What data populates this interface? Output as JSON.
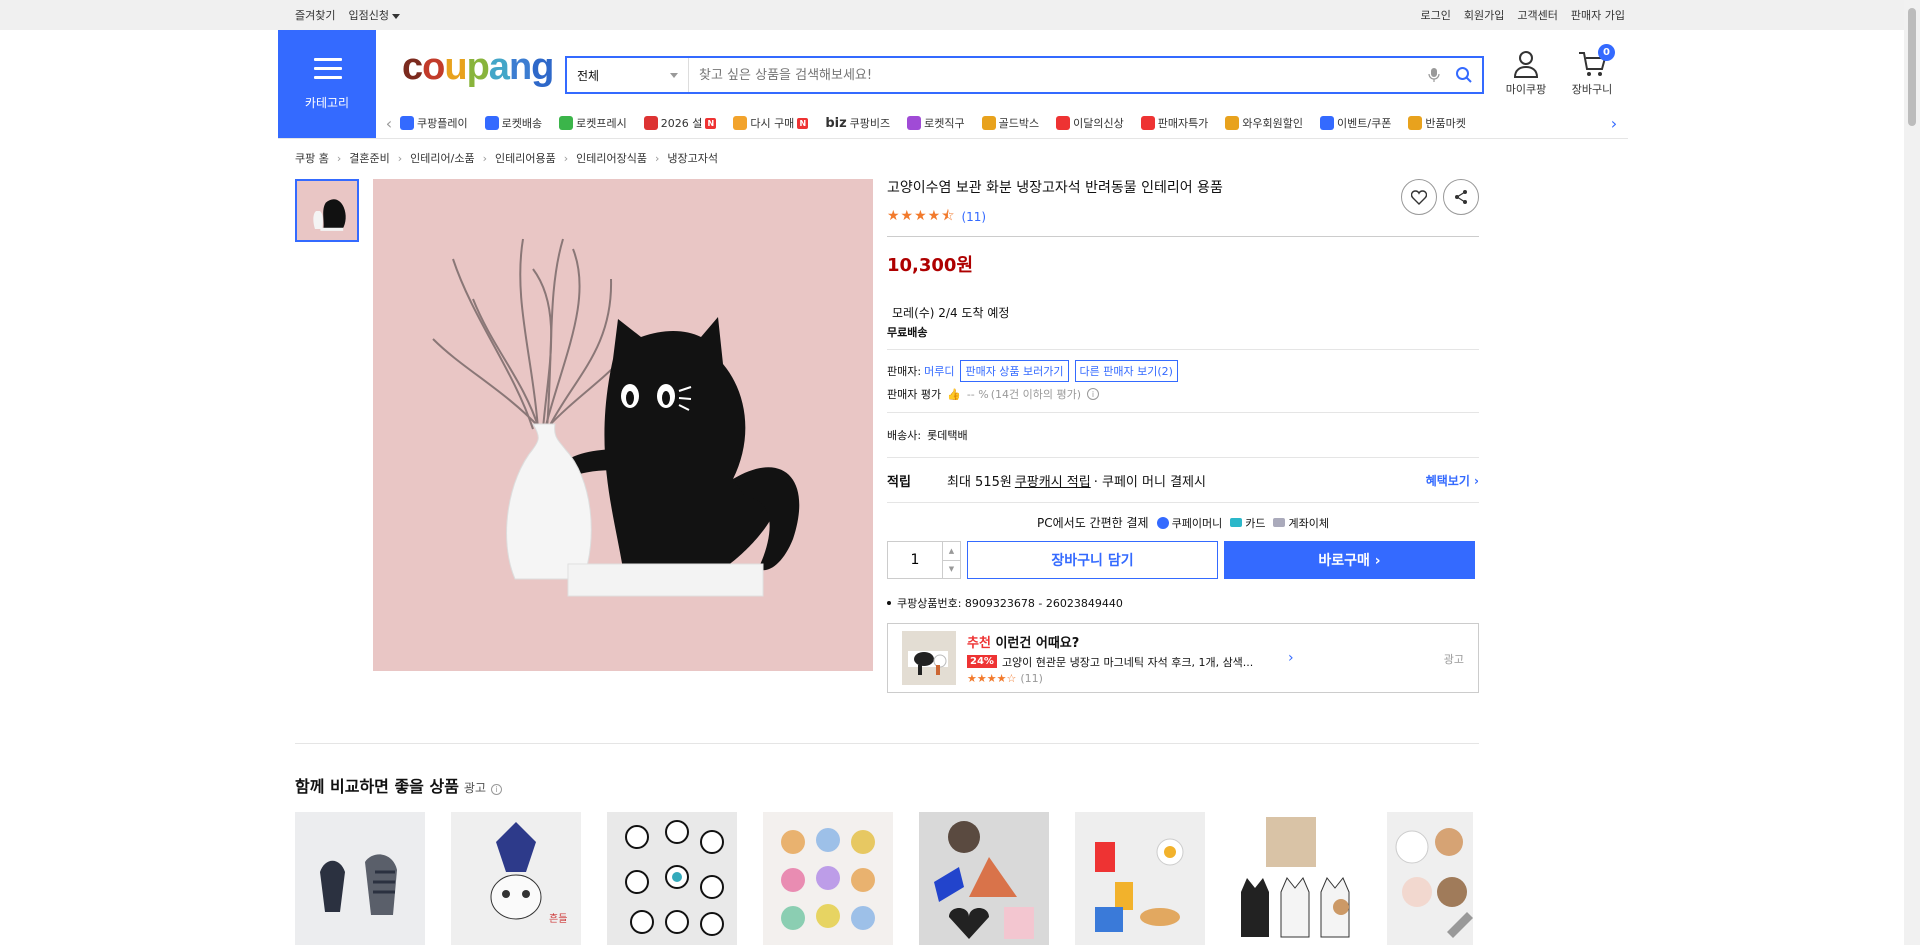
{
  "topbar": {
    "left": [
      "즐겨찾기",
      "입점신청"
    ],
    "right": [
      "로그인",
      "회원가입",
      "고객센터",
      "판매자 가입"
    ]
  },
  "header": {
    "category_label": "카테고리",
    "logo": "coupang",
    "search": {
      "scope": "전체",
      "placeholder": "찾고 싶은 상품을 검색해보세요!"
    },
    "mycoupang": "마이쿠팡",
    "cart": "장바구니",
    "cart_count": "0"
  },
  "nav": [
    {
      "label": "쿠팡플레이",
      "icon": "play-icon",
      "color": "#346aff"
    },
    {
      "label": "로켓배송",
      "icon": "rocket-icon",
      "color": "#346aff"
    },
    {
      "label": "로켓프레시",
      "icon": "rocket-fresh-icon",
      "color": "#3bb54a"
    },
    {
      "label": "2026 설",
      "icon": "gift-icon",
      "color": "#d33",
      "badge": "N"
    },
    {
      "label": "다시 구매",
      "icon": "home-icon",
      "color": "#f2a32c",
      "badge": "N"
    },
    {
      "label": "쿠팡비즈",
      "icon": "biz-icon",
      "color": "#333",
      "prefix": "biz"
    },
    {
      "label": "로켓직구",
      "icon": "globe-icon",
      "color": "#a04bd6"
    },
    {
      "label": "골드박스",
      "icon": "goldbox-icon",
      "color": "#e8a21d"
    },
    {
      "label": "이달의신상",
      "icon": "new-icon",
      "color": "#e33"
    },
    {
      "label": "판매자특가",
      "icon": "percent-icon",
      "color": "#e33"
    },
    {
      "label": "와우회원할인",
      "icon": "wow-icon",
      "color": "#e8a21d"
    },
    {
      "label": "이벤트/쿠폰",
      "icon": "coupon-icon",
      "color": "#346aff"
    },
    {
      "label": "반품마켓",
      "icon": "market-icon",
      "color": "#e8a21d"
    }
  ],
  "breadcrumb": [
    "쿠팡 홈",
    "결혼준비",
    "인테리어/소품",
    "인테리어용품",
    "인테리어장식품",
    "냉장고자석"
  ],
  "product": {
    "title": "고양이수염 보관 화분 냉장고자석 반려동물 인테리어 용품",
    "rating": 4.5,
    "review_count": "(11)",
    "price": "10,300원",
    "delivery": "모레(수) 2/4 도착 예정",
    "free_shipping": "무료배송",
    "seller_label": "판매자:",
    "seller_name": "머루디",
    "seller_products": "판매자 상품 보러가기",
    "other_sellers": "다른 판매자 보기(2)",
    "seller_rating_label": "판매자 평가",
    "seller_rating_value": "-- %",
    "seller_rating_note": "(14건 이하의 평가)",
    "carrier_label": "배송사:",
    "carrier": "롯데택배",
    "reward_label": "적립",
    "reward_pre": "최대 515원",
    "reward_link": "쿠팡캐시 적립",
    "reward_post": "· 쿠페이 머니 결제시",
    "benefit_link": "혜택보기",
    "pay_title": "PC에서도 간편한 결제",
    "pay_methods": [
      "쿠페이머니",
      "카드",
      "계좌이체"
    ],
    "quantity": "1",
    "add_to_cart": "장바구니 담기",
    "buy_now": "바로구매",
    "product_code": "쿠팡상품번호: 8909323678 - 26023849440"
  },
  "recommend": {
    "tag": "추천",
    "title": "이런건 어때요?",
    "discount": "24%",
    "name": "고양이 현관문 냉장고 마그네틱 자석 후크, 1개, 삼색...",
    "reviews": "(11)",
    "ad": "광고"
  },
  "compare": {
    "title": "함께 비교하면 좋을 상품",
    "ad": "광고"
  },
  "colors": {
    "accent": "#346aff",
    "price": "#ae0000",
    "star": "#f27a2c"
  }
}
